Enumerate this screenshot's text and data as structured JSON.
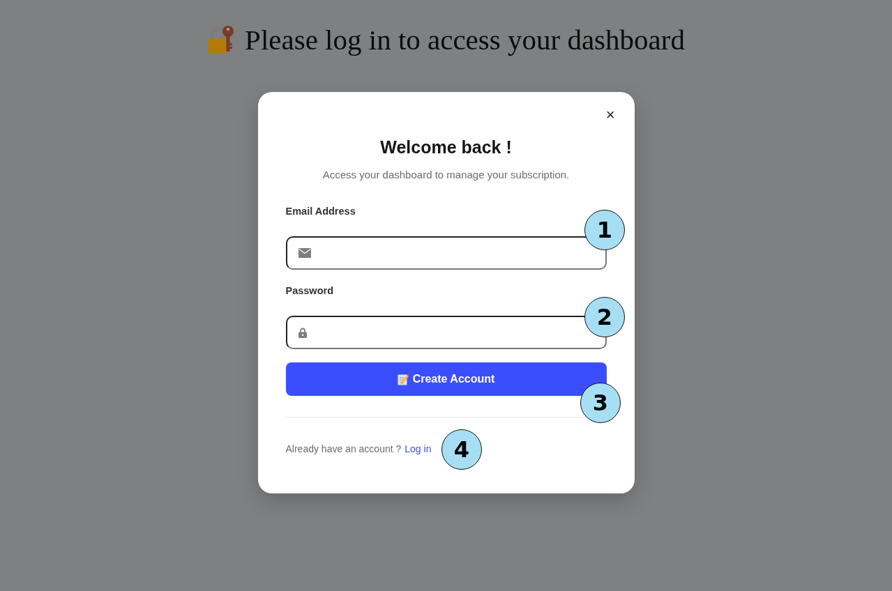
{
  "page": {
    "heading": "Please log in to access your dashboard"
  },
  "modal": {
    "close": "×",
    "title": "Welcome back !",
    "subtitle": "Access your dashboard to manage your subscription.",
    "fields": [
      {
        "kind": "email",
        "label": "Email Address"
      },
      {
        "kind": "password",
        "label": "Password"
      }
    ],
    "submit": "Create Account",
    "footer_text": "Already have an account ?",
    "footer_link": "Log in"
  },
  "markers": [
    "1",
    "2",
    "3",
    "4"
  ]
}
